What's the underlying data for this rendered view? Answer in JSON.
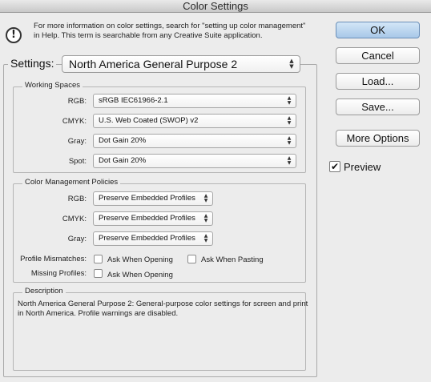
{
  "window": {
    "title": "Color Settings"
  },
  "info": {
    "icon": "alert-info-icon",
    "text": "For more information on color settings, search for \"setting up color management\" in Help. This term is searchable from any Creative Suite application."
  },
  "settings": {
    "label": "Settings:",
    "value": "North America General Purpose 2"
  },
  "working_spaces": {
    "title": "Working Spaces",
    "rows": [
      {
        "label": "RGB:",
        "value": "sRGB IEC61966-2.1"
      },
      {
        "label": "CMYK:",
        "value": "U.S. Web Coated (SWOP) v2"
      },
      {
        "label": "Gray:",
        "value": "Dot Gain 20%"
      },
      {
        "label": "Spot:",
        "value": "Dot Gain 20%"
      }
    ]
  },
  "policies": {
    "title": "Color Management Policies",
    "rows": [
      {
        "label": "RGB:",
        "value": "Preserve Embedded Profiles"
      },
      {
        "label": "CMYK:",
        "value": "Preserve Embedded Profiles"
      },
      {
        "label": "Gray:",
        "value": "Preserve Embedded Profiles"
      }
    ],
    "mismatches_label": "Profile Mismatches:",
    "ask_opening": "Ask When Opening",
    "ask_pasting": "Ask When Pasting",
    "missing_label": "Missing Profiles:",
    "missing_ask_opening": "Ask When Opening"
  },
  "description": {
    "title": "Description",
    "text": "North America General Purpose 2:  General-purpose color settings for screen and print in North America. Profile warnings are disabled."
  },
  "buttons": {
    "ok": "OK",
    "cancel": "Cancel",
    "load": "Load...",
    "save": "Save...",
    "more_options": "More Options"
  },
  "preview": {
    "label": "Preview",
    "checked": true,
    "check_glyph": "✔"
  },
  "popup_arrows": "▲\n▼"
}
